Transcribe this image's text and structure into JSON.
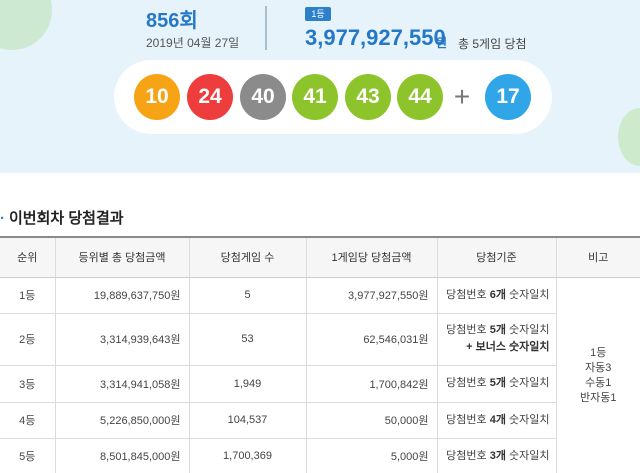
{
  "draw": {
    "number": "856회",
    "date": "2019년 04월 27일"
  },
  "first_prize": {
    "badge": "1등",
    "amount": "3,977,927,550",
    "unit": "원",
    "games": "총 5게임 당첨"
  },
  "numbers": [
    {
      "value": "10",
      "color": "#f6a316"
    },
    {
      "value": "24",
      "color": "#ed3d3d"
    },
    {
      "value": "40",
      "color": "#8b8b8b"
    },
    {
      "value": "41",
      "color": "#8ec42b"
    },
    {
      "value": "43",
      "color": "#8ec42b"
    },
    {
      "value": "44",
      "color": "#8ec42b"
    }
  ],
  "plus": "+",
  "bonus": {
    "value": "17",
    "color": "#30a6e8"
  },
  "section": {
    "marker": "·",
    "title": "이번회차 당첨결과"
  },
  "table": {
    "headers": [
      "순위",
      "등위별 총 당첨금액",
      "당첨게임 수",
      "1게임당 당첨금액",
      "당첨기준",
      "비고"
    ],
    "rows": [
      {
        "rank": "1등",
        "total": "19,889,637,750원",
        "games": "5",
        "per_game": "3,977,927,550원",
        "criteria": {
          "pre": "당첨번호 ",
          "bold": "6개",
          "post": " 숫자일치",
          "line2": ""
        }
      },
      {
        "rank": "2등",
        "total": "3,314,939,643원",
        "games": "53",
        "per_game": "62,546,031원",
        "criteria": {
          "pre": "당첨번호 ",
          "bold": "5개",
          "post": " 숫자일치",
          "line2": "+ 보너스 숫자일치"
        }
      },
      {
        "rank": "3등",
        "total": "3,314,941,058원",
        "games": "1,949",
        "per_game": "1,700,842원",
        "criteria": {
          "pre": "당첨번호 ",
          "bold": "5개",
          "post": " 숫자일치",
          "line2": ""
        }
      },
      {
        "rank": "4등",
        "total": "5,226,850,000원",
        "games": "104,537",
        "per_game": "50,000원",
        "criteria": {
          "pre": "당첨번호 ",
          "bold": "4개",
          "post": " 숫자일치",
          "line2": ""
        }
      },
      {
        "rank": "5등",
        "total": "8,501,845,000원",
        "games": "1,700,369",
        "per_game": "5,000원",
        "criteria": {
          "pre": "당첨번호 ",
          "bold": "3개",
          "post": " 숫자일치",
          "line2": ""
        }
      }
    ],
    "remark": [
      "1등",
      "자동3",
      "수동1",
      "반자동1"
    ]
  }
}
